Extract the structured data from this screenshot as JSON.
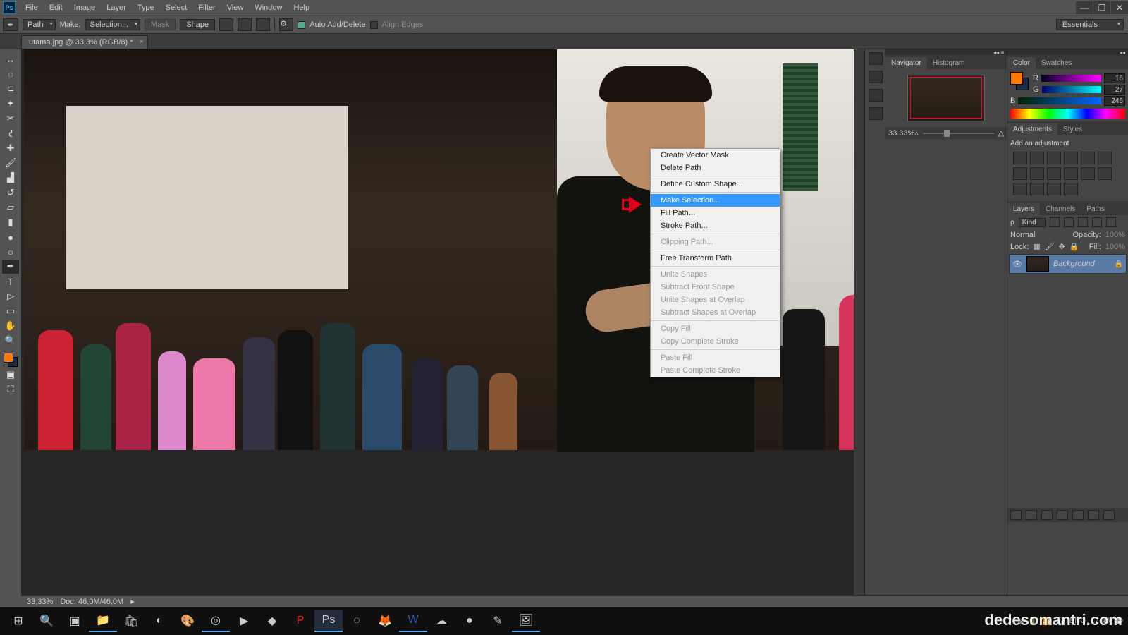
{
  "menu": [
    "File",
    "Edit",
    "Image",
    "Layer",
    "Type",
    "Select",
    "Filter",
    "View",
    "Window",
    "Help"
  ],
  "workspace": "Essentials",
  "optbar": {
    "path": "Path",
    "make_lbl": "Make:",
    "make_val": "Selection...",
    "mask": "Mask",
    "shape": "Shape",
    "auto": "Auto Add/Delete",
    "align": "Align Edges"
  },
  "tab": {
    "title": "utama.jpg @ 33,3% (RGB/8) *"
  },
  "ctx": {
    "items": [
      {
        "t": "Create Vector Mask",
        "dis": false
      },
      {
        "t": "Delete Path",
        "dis": false
      },
      {
        "sep": true
      },
      {
        "t": "Define Custom Shape...",
        "dis": false
      },
      {
        "sep": true
      },
      {
        "t": "Make Selection...",
        "dis": false,
        "hi": true
      },
      {
        "t": "Fill Path...",
        "dis": false
      },
      {
        "t": "Stroke Path...",
        "dis": false
      },
      {
        "sep": true
      },
      {
        "t": "Clipping Path...",
        "dis": true
      },
      {
        "sep": true
      },
      {
        "t": "Free Transform Path",
        "dis": false
      },
      {
        "sep": true
      },
      {
        "t": "Unite Shapes",
        "dis": true
      },
      {
        "t": "Subtract Front Shape",
        "dis": true
      },
      {
        "t": "Unite Shapes at Overlap",
        "dis": true
      },
      {
        "t": "Subtract Shapes at Overlap",
        "dis": true
      },
      {
        "sep": true
      },
      {
        "t": "Copy Fill",
        "dis": true
      },
      {
        "t": "Copy Complete Stroke",
        "dis": true
      },
      {
        "sep": true
      },
      {
        "t": "Paste Fill",
        "dis": true
      },
      {
        "t": "Paste Complete Stroke",
        "dis": true
      }
    ]
  },
  "nav": {
    "tab1": "Navigator",
    "tab2": "Histogram",
    "zoom": "33.33%"
  },
  "color": {
    "tab1": "Color",
    "tab2": "Swatches",
    "R": "16",
    "G": "27",
    "B": "246",
    "r_lbl": "R",
    "g_lbl": "G",
    "b_lbl": "B"
  },
  "adjust": {
    "tab1": "Adjustments",
    "tab2": "Styles",
    "hint": "Add an adjustment"
  },
  "layers": {
    "tabs": [
      "Layers",
      "Channels",
      "Paths"
    ],
    "kind": "Kind",
    "blend": "Normal",
    "opacity_lbl": "Opacity:",
    "opacity": "100%",
    "lock_lbl": "Lock:",
    "fill_lbl": "Fill:",
    "fill": "100%",
    "layer_name": "Background"
  },
  "status": {
    "zoom": "33,33%",
    "doc": "Doc: 46,0M/46,0M"
  },
  "tray": {
    "time": "17.46"
  },
  "watermark": "dedesomantri.com"
}
